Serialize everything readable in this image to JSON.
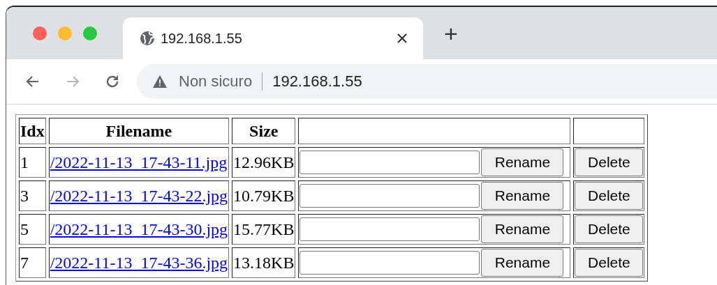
{
  "browser": {
    "tabs": [
      {
        "title": "192.168.1.55",
        "selected": true
      }
    ],
    "new_tab": "+",
    "address_bar": {
      "security": "Non sicuro",
      "url": "192.168.1.55"
    }
  },
  "table": {
    "columns": [
      "Idx",
      "Filename",
      "Size"
    ],
    "rows": [
      {
        "idx": "1",
        "filename": "/2022-11-13_17-43-11.jpg",
        "size": "12.96KB",
        "rename_button": "Rename",
        "delete_button": "Delete"
      },
      {
        "idx": "3",
        "filename": "/2022-11-13_17-43-22.jpg",
        "size": "10.79KB",
        "rename_button": "Rename",
        "delete_button": "Delete"
      },
      {
        "idx": "5",
        "filename": "/2022-11-13_17-43-30.jpg",
        "size": "15.77KB",
        "rename_button": "Rename",
        "delete_button": "Delete"
      },
      {
        "idx": "7",
        "filename": "/2022-11-13_17-43-36.jpg",
        "size": "13.18KB",
        "rename_button": "Rename",
        "delete_button": "Delete"
      }
    ]
  }
}
